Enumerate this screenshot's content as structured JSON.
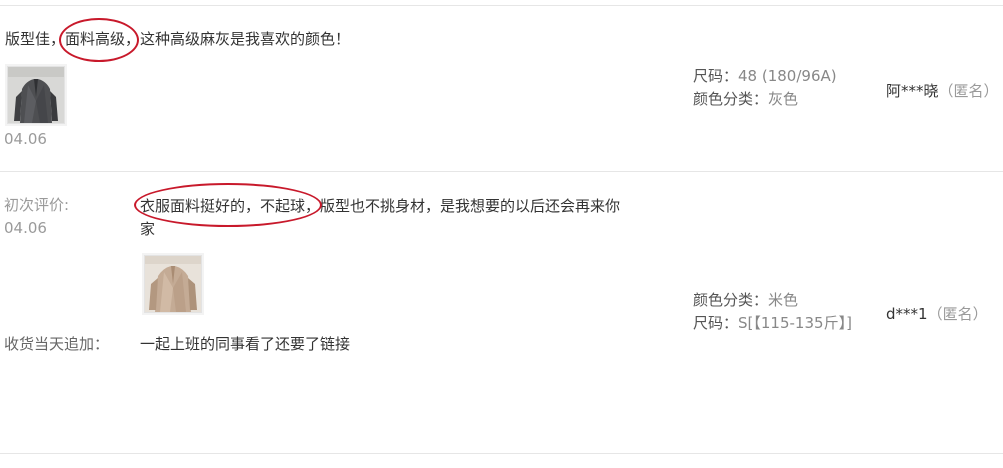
{
  "reviews": [
    {
      "text_before": "版型佳，",
      "highlight": "面料高级",
      "text_after": "，这种高级麻灰是我喜欢的颜色！",
      "date": "04.06",
      "sku": {
        "size_label": "尺码：",
        "size_value": "48 (180/96A)",
        "color_label": "颜色分类：",
        "color_value": "灰色"
      },
      "user_name": "阿***晓",
      "anonymous": "（匿名）"
    },
    {
      "initial_label": "初次评价:",
      "date": "04.06",
      "highlight": "衣服面料挺好的，不起球",
      "text_after_line1": "，版型也不挑身材，是我想要的以后还会再来你",
      "text_line2": "家",
      "append_label": "收货当天追加：",
      "append_text": "一起上班的同事看了还要了链接",
      "sku": {
        "color_label": "颜色分类：",
        "color_value": "米色",
        "size_label": "尺码：",
        "size_value": "S[【115-135斤】]"
      },
      "user_name": "d***1",
      "anonymous": "（匿名）"
    }
  ],
  "colors": {
    "annotation_red": "#c8192b",
    "divider": "#e6e6e6",
    "muted_text": "#9a9a9a"
  },
  "icons": {
    "photo_1": "gray-jacket-photo",
    "photo_2": "beige-jacket-photo"
  }
}
